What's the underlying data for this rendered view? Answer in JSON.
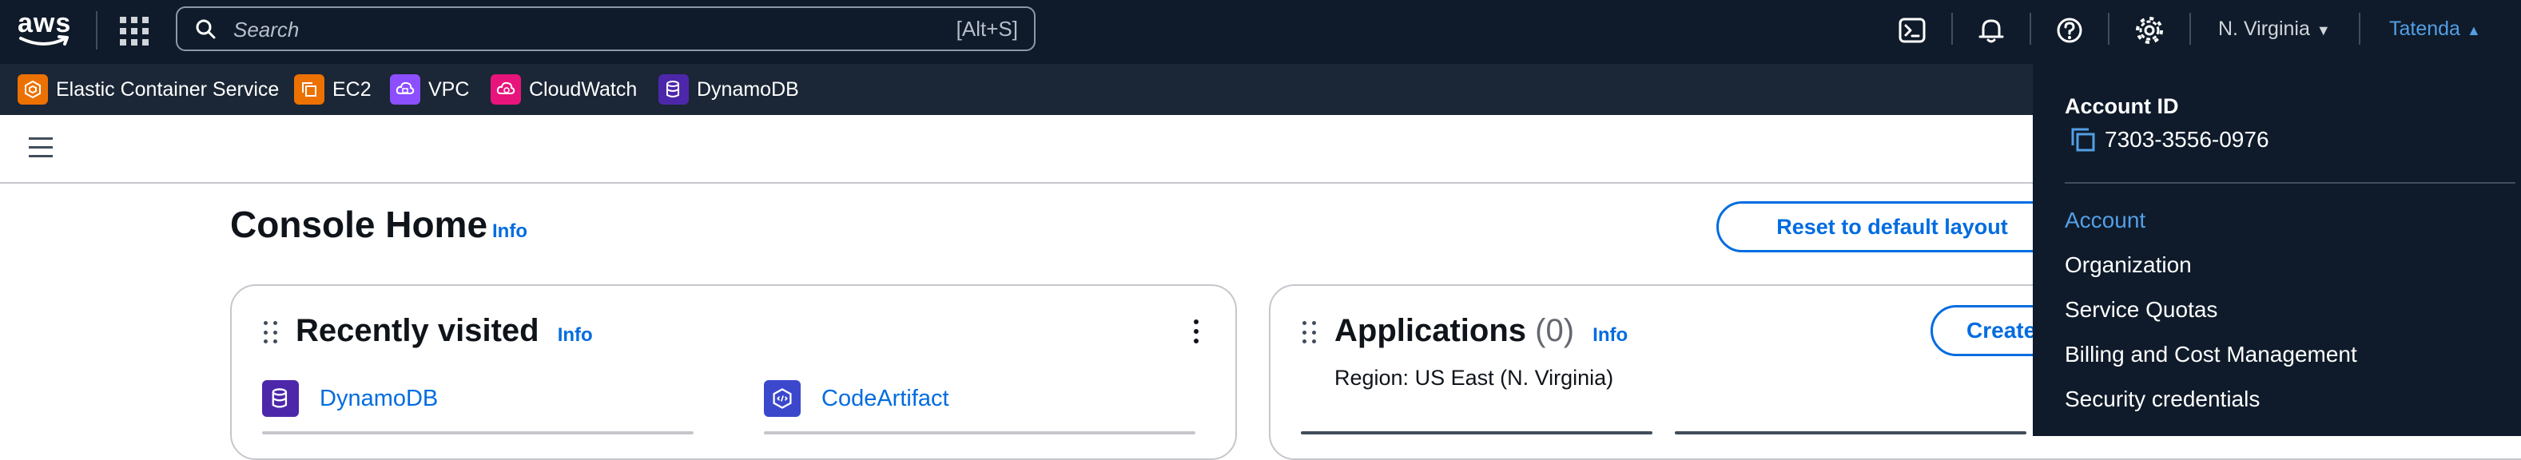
{
  "top_nav": {
    "logo_text": "aws",
    "search": {
      "placeholder": "Search",
      "shortcut": "[Alt+S]"
    },
    "icons": [
      "cloudshell-icon",
      "bell-icon",
      "help-icon",
      "gear-icon"
    ],
    "region": "N. Virginia",
    "user": "Tatenda"
  },
  "favorites": [
    {
      "label": "Elastic Container Service",
      "color": "#ed7100"
    },
    {
      "label": "EC2",
      "color": "#ed7100"
    },
    {
      "label": "VPC",
      "color": "#8c4fff"
    },
    {
      "label": "CloudWatch",
      "color": "#e7157b"
    },
    {
      "label": "DynamoDB",
      "color": "#4d27aa"
    }
  ],
  "main": {
    "title": "Console Home",
    "title_info": "Info",
    "reset_button": "Reset to default layout"
  },
  "recently_visited": {
    "title": "Recently visited",
    "info": "Info",
    "items": [
      {
        "label": "DynamoDB",
        "color": "#4d27aa"
      },
      {
        "label": "CodeArtifact",
        "color": "#3b48cc"
      }
    ]
  },
  "applications": {
    "title": "Applications",
    "count": "(0)",
    "info": "Info",
    "region": "Region: US East (N. Virginia)",
    "create_button": "Create"
  },
  "account_menu": {
    "id_label": "Account ID",
    "id_value": "7303-3556-0976",
    "items": [
      {
        "label": "Account",
        "active": true
      },
      {
        "label": "Organization"
      },
      {
        "label": "Service Quotas"
      },
      {
        "label": "Billing and Cost Management"
      },
      {
        "label": "Security credentials"
      }
    ]
  },
  "colors": {
    "nav_bg": "#0f1b2a",
    "favorites_bg": "#1b2636",
    "link_blue": "#006ce0",
    "active_blue": "#539fe5"
  }
}
